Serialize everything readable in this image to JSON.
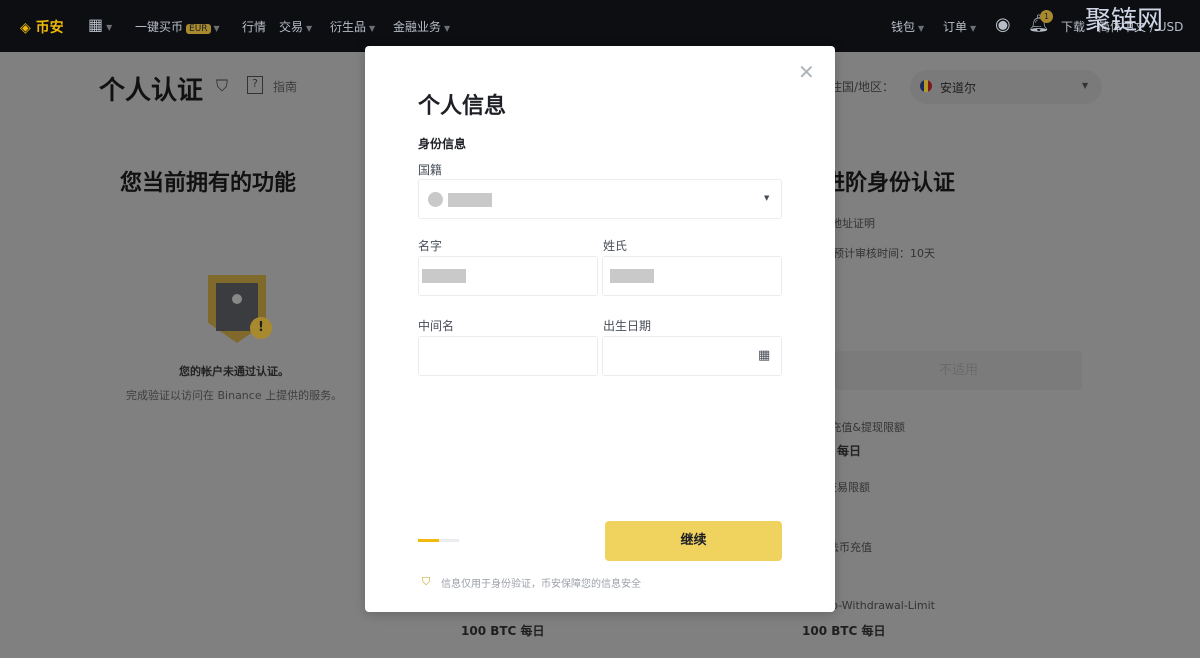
{
  "nav": {
    "logo": "币安",
    "buy": "一键买币",
    "currency_badge": "EUR",
    "markets": "行情",
    "trade": "交易",
    "derivatives": "衍生品",
    "finance": "金融业务",
    "wallet": "钱包",
    "orders": "订单",
    "notifications_count": "1",
    "download": "下载",
    "language": "简体中文",
    "fiat": "USD",
    "watermark": "聚链网"
  },
  "page": {
    "title": "个人认证",
    "guide": "指南",
    "residence_label": "居住国/地区：",
    "residence_value": "安道尔",
    "features_title": "您当前拥有的功能",
    "unverified": "您的帐户未通过认证。",
    "unverified_desc": "完成验证以访问在 Binance 上提供的服务。",
    "right_title": "进阶身份认证",
    "right_item1": "地址证明",
    "right_review": "预计审核时间：10天",
    "right_button": "不适用",
    "limit1_label": "充值&提现限额",
    "limit1_value": "每日",
    "limit2_label": "交易限额",
    "limit3_label": "法币充值",
    "limit4_label": "Crypto-Withdrawal-Limit",
    "left_limit_value": "100 BTC 每日",
    "right_limit_value": "100 BTC 每日"
  },
  "modal": {
    "title": "个人信息",
    "section": "身份信息",
    "nationality_label": "国籍",
    "first_name_label": "名字",
    "last_name_label": "姓氏",
    "middle_name_label": "中间名",
    "dob_label": "出生日期",
    "continue": "继续",
    "notice": "信息仅用于身份验证，币安保障您的信息安全",
    "progress_percent": 50
  },
  "colors": {
    "accent": "#f0b90b",
    "button": "#f0d25f",
    "nav_bg": "#0d0e12"
  }
}
